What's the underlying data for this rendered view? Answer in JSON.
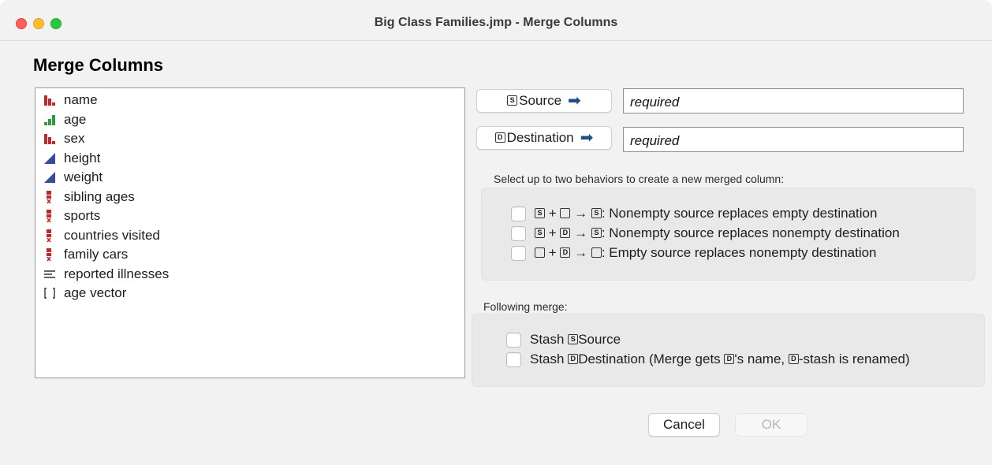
{
  "window": {
    "title": "Big Class Families.jmp - Merge Columns"
  },
  "dialog": {
    "title": "Merge Columns"
  },
  "columns": [
    {
      "label": "name",
      "icon": "nominal-icon"
    },
    {
      "label": "age",
      "icon": "ordinal-icon"
    },
    {
      "label": "sex",
      "icon": "nominal-icon"
    },
    {
      "label": "height",
      "icon": "continuous-icon"
    },
    {
      "label": "weight",
      "icon": "continuous-icon"
    },
    {
      "label": "sibling ages",
      "icon": "multiple-response-icon"
    },
    {
      "label": "sports",
      "icon": "multiple-response-icon"
    },
    {
      "label": "countries visited",
      "icon": "multiple-response-icon"
    },
    {
      "label": "family cars",
      "icon": "multiple-response-icon"
    },
    {
      "label": "reported illnesses",
      "icon": "unstructured-text-icon"
    },
    {
      "label": "age vector",
      "icon": "vector-icon"
    }
  ],
  "roles": {
    "source": {
      "letter": "S",
      "label": "Source",
      "value": "required"
    },
    "destination": {
      "letter": "D",
      "label": "Destination",
      "value": "required"
    }
  },
  "behaviors": {
    "heading": "Select up to two behaviors to create a new merged column:",
    "options": [
      {
        "a": "S",
        "b": "",
        "result": "S",
        "text": ": Nonempty source replaces empty destination",
        "checked": false
      },
      {
        "a": "S",
        "b": "D",
        "result": "S",
        "text": ": Nonempty source replaces nonempty destination",
        "checked": false
      },
      {
        "a": "",
        "b": "D",
        "result": "",
        "text": ": Empty source replaces nonempty destination",
        "checked": false
      }
    ]
  },
  "following": {
    "heading": "Following merge:",
    "stash_source": {
      "prefix": "Stash ",
      "letter": "S",
      "suffix": "Source",
      "checked": false
    },
    "stash_destination": {
      "prefix": "Stash ",
      "letter": "D",
      "suffix": "Destination (Merge gets ",
      "letter2": "D",
      "suffix2": "'s name, ",
      "letter3": "D",
      "suffix3": "-stash is renamed)",
      "checked": false
    }
  },
  "buttons": {
    "cancel": "Cancel",
    "ok": "OK"
  },
  "colors": {
    "nominal": "#c0282b",
    "ordinal": "#2e9a3a",
    "continuous": "#3b4b9c",
    "arrow": "#1e4e89"
  }
}
